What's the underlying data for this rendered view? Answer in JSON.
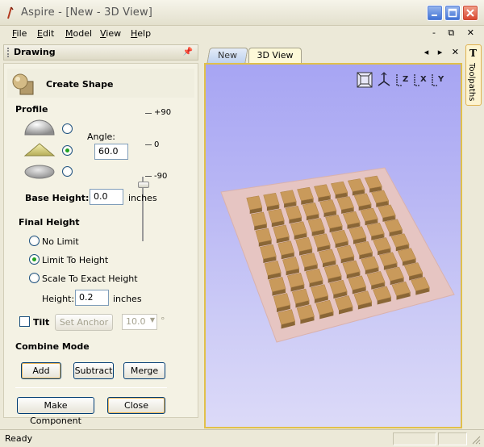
{
  "window": {
    "title": "Aspire - [New - 3D View]"
  },
  "menu": {
    "items": [
      "File",
      "Edit",
      "Model",
      "View",
      "Help"
    ],
    "right_controls": "- ⧉ ✕"
  },
  "drawing_panel": {
    "title": "Drawing"
  },
  "create_shape": {
    "title": "Create Shape",
    "profile": {
      "label": "Profile",
      "selected": "cone",
      "angle_label": "Angle:",
      "angle_value": "60.0",
      "slider_ticks": [
        "+90",
        "0",
        "-90"
      ],
      "slider_value": 60
    },
    "base_height": {
      "label": "Base Height:",
      "value": "0.0",
      "unit": "inches"
    },
    "final_height": {
      "label": "Final Height",
      "options": [
        "No Limit",
        "Limit To Height",
        "Scale To Exact Height"
      ],
      "selected_index": 1,
      "height_label": "Height:",
      "height_value": "0.2",
      "unit": "inches"
    },
    "tilt": {
      "label": "Tilt",
      "checked": false,
      "set_anchor_label": "Set Anchor",
      "value": "10.0",
      "degree": "°"
    },
    "combine_mode": {
      "label": "Combine Mode",
      "buttons": [
        "Add",
        "Subtract",
        "Merge"
      ]
    },
    "make_component_label": "Make Component",
    "close_label": "Close"
  },
  "tabs": {
    "items": [
      "New",
      "3D View"
    ],
    "active_index": 1,
    "controls": "◂ ▸ ✕"
  },
  "view_toolbar": {
    "icons": [
      "zoom-extents-icon",
      "iso-view-icon",
      "top-view-icon",
      "front-view-icon",
      "side-view-icon"
    ],
    "axis_labels": [
      "Z",
      "X",
      "Y"
    ]
  },
  "toolpaths_tab": {
    "icon": "T",
    "label": "Toolpaths"
  },
  "status": {
    "text": "Ready"
  },
  "colors": {
    "viewport_border": "#e1c04a",
    "radio_checked": "#21a121",
    "tile": "#c99a5b",
    "sheet": "#e6c5c2"
  }
}
